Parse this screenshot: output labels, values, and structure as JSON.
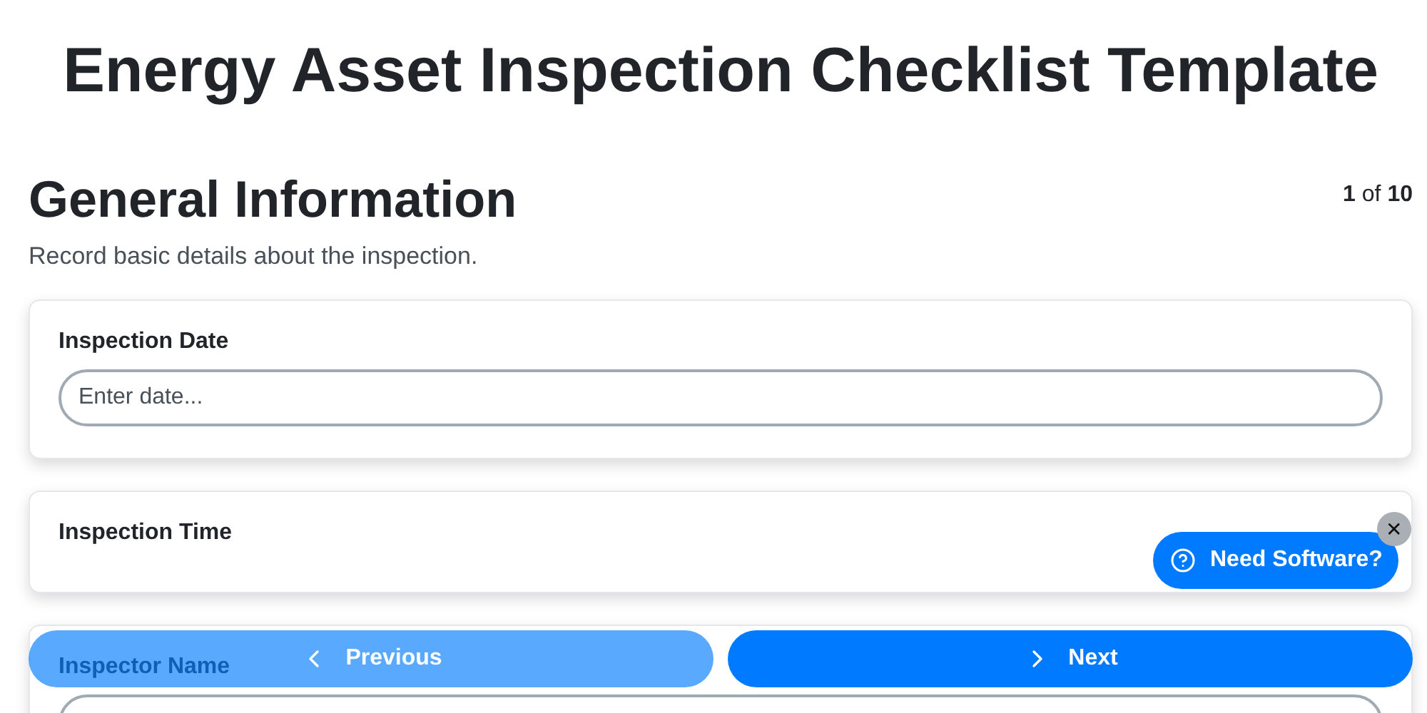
{
  "page_title": "Energy Asset Inspection Checklist Template",
  "section": {
    "title": "General Information",
    "step_current": "1",
    "step_of": "of",
    "step_total": "10",
    "description": "Record basic details about the inspection."
  },
  "fields": [
    {
      "label": "Inspection Date",
      "kind": "input",
      "placeholder": "Enter date..."
    },
    {
      "label": "Inspection Time",
      "kind": "label"
    },
    {
      "label": "Inspector Name",
      "kind": "input"
    }
  ],
  "navigation": [
    {
      "label": "Previous",
      "kind": "prev",
      "disabled": true
    },
    {
      "label": "Next",
      "kind": "next",
      "disabled": false
    }
  ],
  "promo": {
    "label": "Need Software?",
    "close": "✕"
  }
}
